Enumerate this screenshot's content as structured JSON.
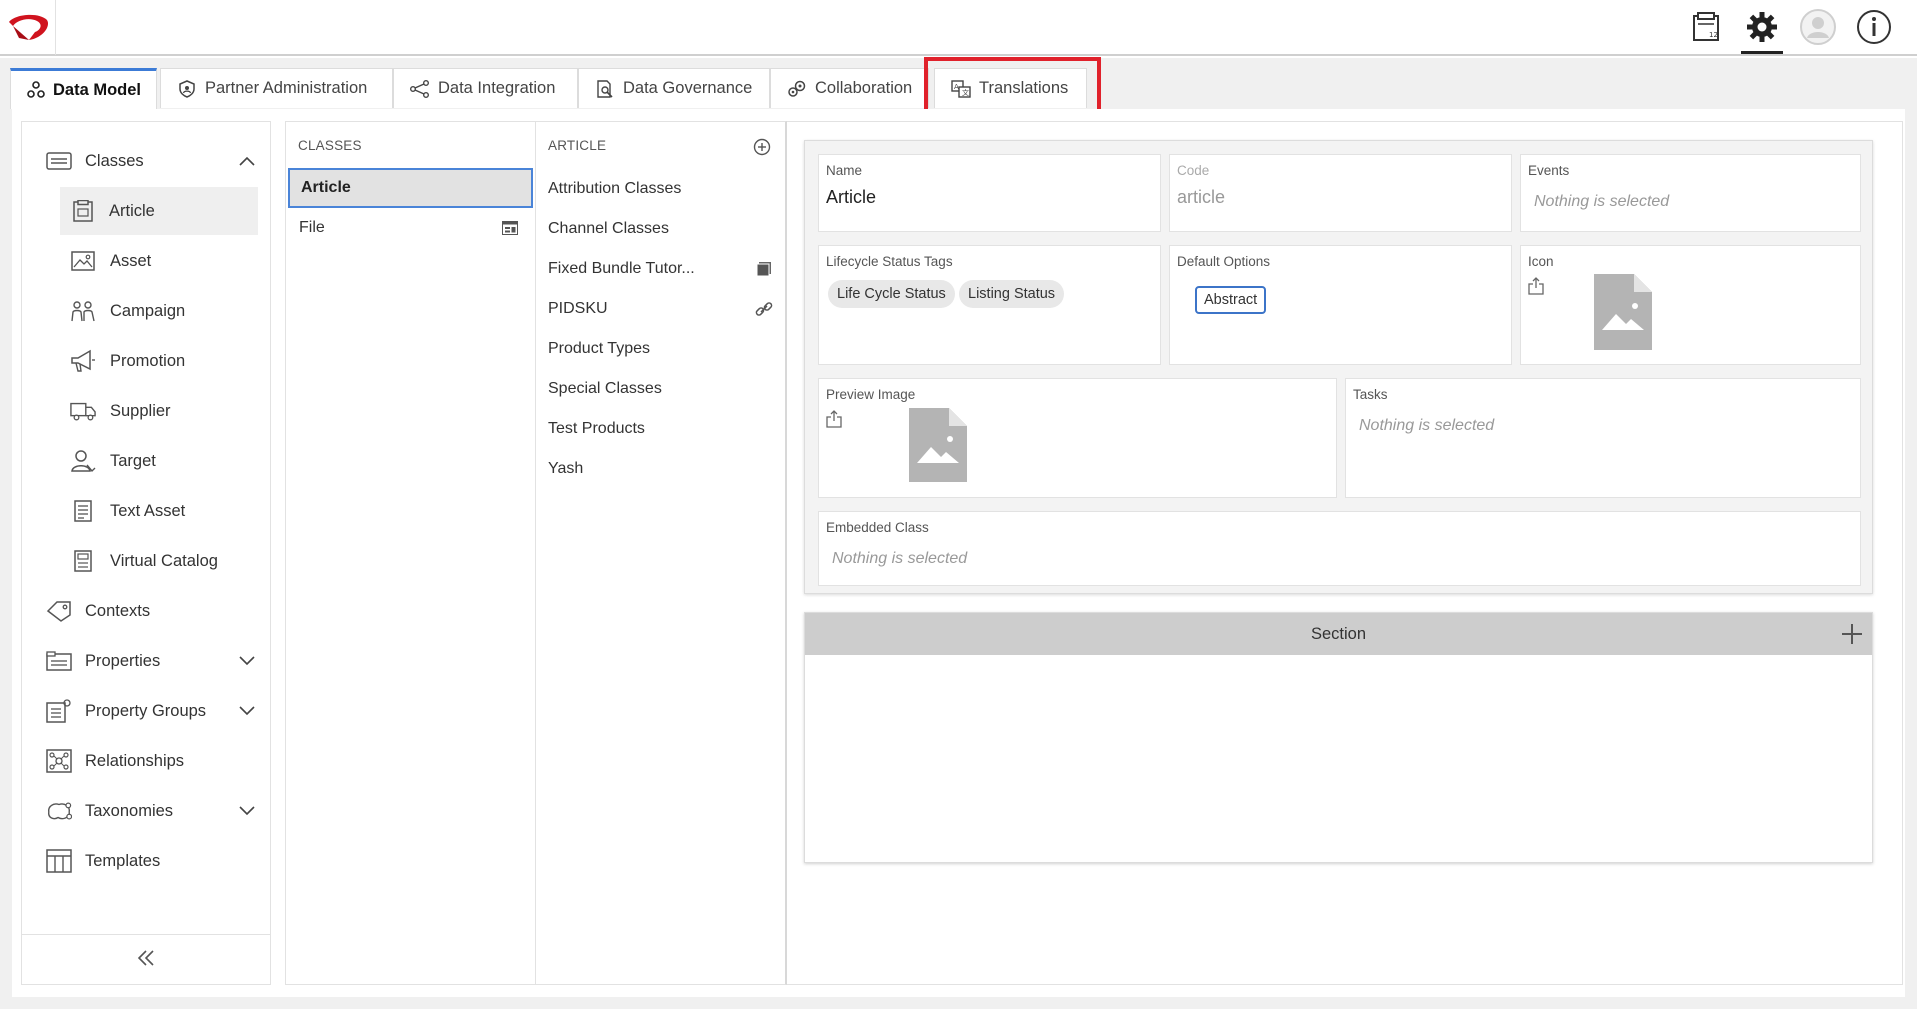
{
  "app": {
    "title": "Data Model"
  },
  "topbar": {
    "icons": [
      "inbox-icon",
      "gear-icon",
      "user-avatar-icon",
      "info-icon"
    ]
  },
  "tabs": [
    {
      "label": "Data Model",
      "icon": "data-model-icon",
      "active": true
    },
    {
      "label": "Partner Administration",
      "icon": "shield-icon",
      "active": false
    },
    {
      "label": "Data Integration",
      "icon": "integration-icon",
      "active": false
    },
    {
      "label": "Data Governance",
      "icon": "governance-icon",
      "active": false
    },
    {
      "label": "Collaboration",
      "icon": "collaboration-icon",
      "active": false
    },
    {
      "label": "Translations",
      "icon": "translations-icon",
      "active": false,
      "highlighted": true
    }
  ],
  "leftnav": {
    "items": [
      {
        "label": "Classes",
        "icon": "classes-icon",
        "expanded": true
      },
      {
        "label": "Article",
        "icon": "article-icon",
        "child": true,
        "selected": true
      },
      {
        "label": "Asset",
        "icon": "asset-icon",
        "child": true
      },
      {
        "label": "Campaign",
        "icon": "campaign-icon",
        "child": true
      },
      {
        "label": "Promotion",
        "icon": "megaphone-icon",
        "child": true
      },
      {
        "label": "Supplier",
        "icon": "truck-icon",
        "child": true
      },
      {
        "label": "Target",
        "icon": "target-user-icon",
        "child": true
      },
      {
        "label": "Text Asset",
        "icon": "text-doc-icon",
        "child": true
      },
      {
        "label": "Virtual Catalog",
        "icon": "catalog-icon",
        "child": true
      },
      {
        "label": "Contexts",
        "icon": "tag-icon"
      },
      {
        "label": "Properties",
        "icon": "properties-icon",
        "expandable": true
      },
      {
        "label": "Property Groups",
        "icon": "property-groups-icon",
        "expandable": true
      },
      {
        "label": "Relationships",
        "icon": "relationships-icon"
      },
      {
        "label": "Taxonomies",
        "icon": "taxonomies-icon",
        "expandable": true
      },
      {
        "label": "Templates",
        "icon": "templates-icon"
      }
    ],
    "collapse_icon": "double-chevron-left-icon"
  },
  "classes_column": {
    "header": "CLASSES",
    "rows": [
      {
        "label": "Article",
        "selected": true
      },
      {
        "label": "File",
        "icon": "file-class-icon"
      }
    ]
  },
  "article_column": {
    "header": "ARTICLE",
    "rows": [
      {
        "label": "Attribution Classes"
      },
      {
        "label": "Channel Classes"
      },
      {
        "label": "Fixed Bundle Tutor...",
        "icon": "bundle-icon"
      },
      {
        "label": "PIDSKU",
        "icon": "link-icon"
      },
      {
        "label": "Product Types"
      },
      {
        "label": "Special Classes"
      },
      {
        "label": "Test Products"
      },
      {
        "label": "Yash"
      }
    ]
  },
  "form": {
    "name_label": "Name",
    "name_value": "Article",
    "code_label": "Code",
    "code_value": "article",
    "events_label": "Events",
    "events_placeholder": "Nothing is selected",
    "lifecycle_label": "Lifecycle Status Tags",
    "lifecycle_tags": [
      "Life Cycle Status",
      "Listing Status"
    ],
    "default_options_label": "Default Options",
    "default_option": "Abstract",
    "icon_label": "Icon",
    "preview_label": "Preview Image",
    "tasks_label": "Tasks",
    "tasks_placeholder": "Nothing is selected",
    "embedded_label": "Embedded Class",
    "embedded_placeholder": "Nothing is selected"
  },
  "section": {
    "title": "Section"
  }
}
